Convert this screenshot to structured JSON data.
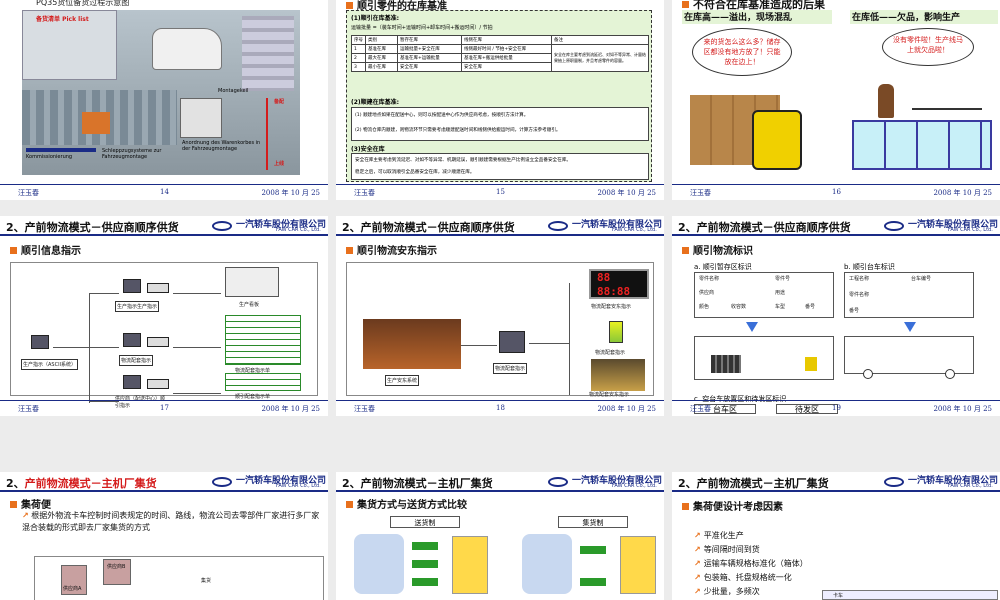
{
  "slides": [
    {
      "title_top": "PQ35货位备货过程示意图",
      "pick_label": "备货清单 Pick list",
      "labels": [
        "Montagekeil",
        "Kommissionierung",
        "Schleppzugsysteme zur Fahrzeugmontage",
        "Anordnung des Warenkorbes in der Fahrzeugmontage",
        "备配",
        "上线"
      ],
      "footer": {
        "author": "汪玉春",
        "page": "14",
        "date": "2008 年 10 月 25"
      }
    },
    {
      "section": "顺引零件的在库基准",
      "s1_title": "(1)顺引在库基准:",
      "formula": "运输批量 =（装车时间+运输时间+卸车时间+搬运时间）/ 节拍",
      "table_head": [
        "序号",
        "类别",
        "暂存在库",
        "线侧在库",
        "备注"
      ],
      "table_rows": [
        [
          "1",
          "基准在库",
          "运输批量+安全在库",
          "线侧最好时间 / 节拍+安全在库"
        ],
        [
          "2",
          "最大在库",
          "基准在库+运输批量",
          "基准在库+搬运供给批量"
        ],
        [
          "3",
          "最小在库",
          "安全在库",
          "安全在库"
        ]
      ],
      "table_note": "安全在库主要考虑到流延迟、对如不等异常、计量结果抽上原职量制，并且考虑零件的容量。",
      "s2_title": "(2)顺建在库基准:",
      "s2_lines": [
        "(1) 顺建地点如果在配送中心，则可以按配送中心作为供应商考虑，按顺引方法计算。",
        "(2) 物流仓库内顺建，则物流环节只需要考虑顺建配送时间和线侧供给搬运时间，计算方法参考顺引。"
      ],
      "s3_title": "(3)安全在库",
      "s3_lines": [
        "安全在库主要考虑到流延迟、对如不等异常、机期延误，顺引顺建需要根据生产比例设立全品番安全在库。",
        "稳定之后，可以取消顺引全品番安全在库，减少顺建在库。"
      ],
      "footer": {
        "author": "汪玉春",
        "page": "15",
        "date": "2008 年 10 月 25"
      }
    },
    {
      "section": "不符合在库基准造成的后果",
      "left_head": "在库高——溢出，现场混乱",
      "right_head": "在库低——欠品，影响生产",
      "bubble_left": "来的货怎么这么多？储存区都没有地方放了！只能放在边上！",
      "bubble_right": "没有零件啦！生产线马上就欠品啦！",
      "footer": {
        "author": "汪玉春",
        "page": "16",
        "date": "2008 年 10 月 25"
      }
    },
    {
      "title": "2、产前物流模式－供应商顺序供货",
      "section": "顺引信息指示",
      "nodes": [
        "生产指示（ASCII系统）",
        "生产指示生产指示",
        "物流配套指示",
        "供应商（配送中心）顺引指示",
        "生产看板",
        "物流配套指示单",
        "顺引配套指示单"
      ],
      "footer": {
        "author": "汪玉春",
        "page": "17",
        "date": "2008 年 10 月 25"
      }
    },
    {
      "title": "2、产前物流模式－供应商顺序供货",
      "section": "顺引物流安东指示",
      "nodes": [
        "生产安东系统",
        "物流配套指示",
        "物流配套安东指示",
        "物流配套指示",
        "物流配套安东指示"
      ],
      "digits": [
        "88",
        "88:88"
      ],
      "footer": {
        "author": "汪玉春",
        "page": "18",
        "date": "2008 年 10 月 25"
      }
    },
    {
      "title": "2、产前物流模式－供应商顺序供货",
      "section": "顺引物流标识",
      "sub_a": "a. 顺引暂存区标识",
      "sub_b": "b. 顺引台车标识",
      "sub_c": "c. 空台车放置区和待发区标识",
      "a_fields": [
        "零件名称",
        "零件号",
        "供应商",
        "用途",
        "颜色",
        "收容数",
        "车型",
        "番号"
      ],
      "b_fields": [
        "工程名称",
        "台车编号",
        "零件名称",
        "番号"
      ],
      "zones": [
        "台车区",
        "待发区"
      ],
      "footer": {
        "author": "汪玉春",
        "page": "19",
        "date": "2008 年 10 月 25"
      }
    },
    {
      "title_prefix": "2、",
      "title_red": "产前物流模式－主机厂集货",
      "section": "集荷便",
      "body": "根据外物流卡车控制时间表规定的时间、路线，物流公司去零部件厂家进行多厂家混合装载的形式即去厂家集货的方式",
      "nodes": [
        "供应商A",
        "供应商B",
        "集货"
      ]
    },
    {
      "title": "2、产前物流模式－主机厂集货",
      "section": "集货方式与送货方式比较",
      "left_label": "送货制",
      "right_label": "集货制"
    },
    {
      "title": "2、产前物流模式－主机厂集货",
      "section": "集荷便设计考虑因素",
      "bullets": [
        "平准化生产",
        "等间隔时间到货",
        "运输车辆规格标准化（箱体）",
        "包装箱、托盘规格统一化",
        "少批量，多频次"
      ],
      "mini_label": "卡车"
    }
  ],
  "logo": {
    "cn": "一汽轿车股份有限公司",
    "en": "FAW CAR Co., Ltd."
  },
  "colors": {
    "navy": "#1a2b86",
    "orange": "#e8701c",
    "red": "#d41c1c",
    "lightgreen": "#e4f4d6"
  }
}
